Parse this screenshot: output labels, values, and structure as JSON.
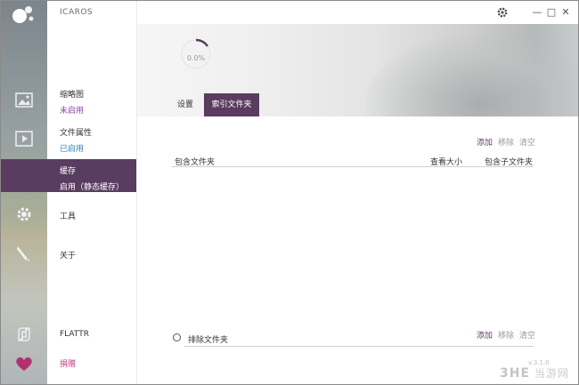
{
  "app": {
    "name": "ICAROS"
  },
  "window": {
    "settings_icon": "gear-icon",
    "minimize": "—",
    "maximize": "□",
    "close": "✕"
  },
  "nav": {
    "thumbnails": {
      "title": "缩略图",
      "status": "未启用",
      "status_color": "#8e44ad"
    },
    "properties": {
      "title": "文件属性",
      "status": "已启用",
      "status_color": "#2e86c1"
    },
    "cache": {
      "title": "缓存",
      "status": "启用（静态缓存）"
    },
    "tools": {
      "title": "工具"
    },
    "about": {
      "title": "关于"
    },
    "flattr": {
      "title": "FLATTR"
    },
    "donate": {
      "title": "捐赠",
      "color": "#c0398a"
    }
  },
  "header": {
    "progress_text": "0.0%",
    "progress_fraction": 0.0
  },
  "tabs": [
    {
      "label": "设置"
    },
    {
      "label": "索引文件夹"
    }
  ],
  "include": {
    "actions": {
      "add": "添加",
      "remove": "移除",
      "clear": "清空"
    },
    "columns": {
      "folder": "包含文件夹",
      "size": "查看大小",
      "subfolders": "包含子文件夹"
    }
  },
  "exclude": {
    "label": "排除文件夹",
    "actions": {
      "add": "添加",
      "remove": "移除",
      "clear": "清空"
    }
  },
  "watermark": {
    "logo": "3HE",
    "text": "当游网",
    "version": "v.3.1.0"
  },
  "colors": {
    "accent": "#5a3c60"
  }
}
